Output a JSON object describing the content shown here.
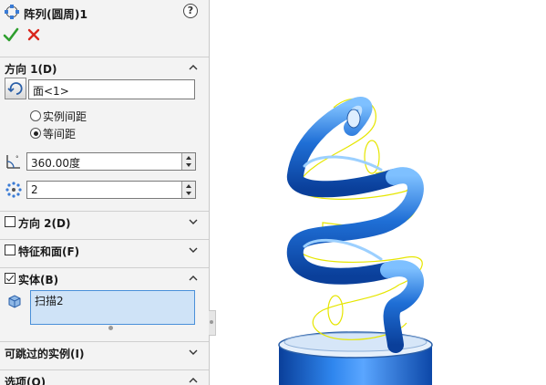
{
  "feature": {
    "title": "阵列(圆周)1",
    "help_icon": "help-icon",
    "ok_icon": "checkmark-icon",
    "cancel_icon": "close-icon"
  },
  "direction1": {
    "header": "方向 1(D)",
    "expanded": true,
    "face_value": "面<1>",
    "radio_instance_spacing": "实例间距",
    "radio_equal_spacing": "等间距",
    "selected_radio": "等间距",
    "angle_value": "360.00度",
    "count_value": "2"
  },
  "direction2": {
    "header": "方向 2(D)",
    "checked": false,
    "expanded": false
  },
  "features_faces": {
    "header": "特征和面(F)",
    "checked": false,
    "expanded": false
  },
  "bodies": {
    "header": "实体(B)",
    "checked": true,
    "expanded": true,
    "items": [
      "扫描2"
    ]
  },
  "skip_instances": {
    "header": "可跳过的实例(I)",
    "expanded": false
  },
  "options": {
    "header": "选项(O)",
    "expanded": true
  },
  "colors": {
    "accent_green": "#2e9e2e",
    "accent_red": "#d9261c",
    "spring_blue": "#1f6fd6",
    "selection_bg": "#cfe3f7",
    "preview_yellow": "#e6e600"
  }
}
